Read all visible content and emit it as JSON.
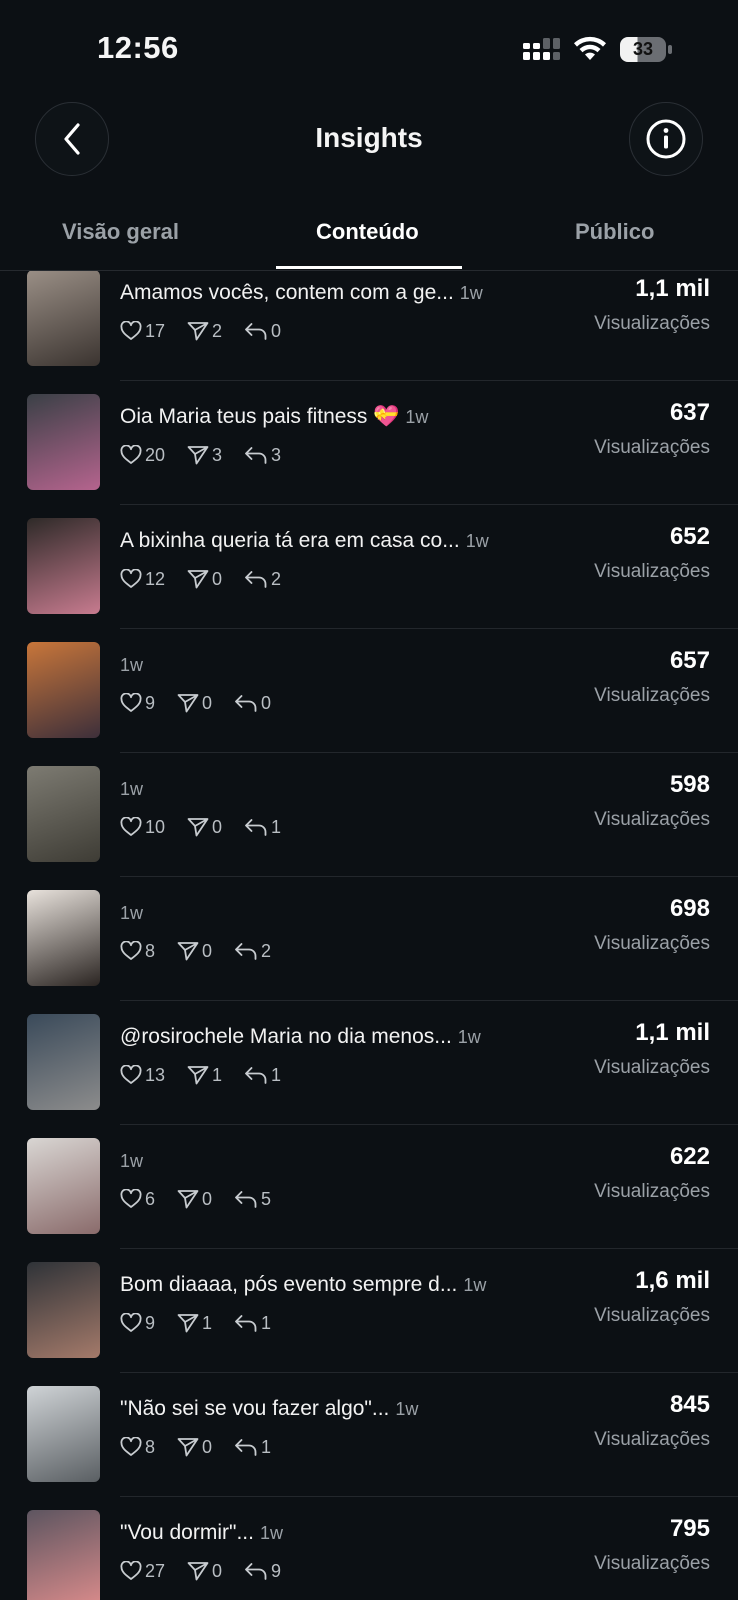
{
  "status": {
    "time": "12:56",
    "battery": "33"
  },
  "header": {
    "title": "Insights"
  },
  "tabs": [
    {
      "label": "Visão geral"
    },
    {
      "label": "Conteúdo"
    },
    {
      "label": "Público"
    }
  ],
  "views_label": "Visualizações",
  "posts": [
    {
      "caption": "Amamos vocês, contem com a ge...",
      "age": "1w",
      "likes": "17",
      "shares": "2",
      "replies": "0",
      "views": "1,1 mil"
    },
    {
      "caption": "Oia Maria teus pais fitness 💝",
      "age": "1w",
      "likes": "20",
      "shares": "3",
      "replies": "3",
      "views": "637"
    },
    {
      "caption": "A bixinha queria tá era em casa co...",
      "age": "1w",
      "likes": "12",
      "shares": "0",
      "replies": "2",
      "views": "652"
    },
    {
      "caption": "",
      "age": "1w",
      "likes": "9",
      "shares": "0",
      "replies": "0",
      "views": "657"
    },
    {
      "caption": "",
      "age": "1w",
      "likes": "10",
      "shares": "0",
      "replies": "1",
      "views": "598"
    },
    {
      "caption": "",
      "age": "1w",
      "likes": "8",
      "shares": "0",
      "replies": "2",
      "views": "698"
    },
    {
      "caption": "@rosirochele  Maria no dia menos...",
      "age": "1w",
      "likes": "13",
      "shares": "1",
      "replies": "1",
      "views": "1,1 mil"
    },
    {
      "caption": "",
      "age": "1w",
      "likes": "6",
      "shares": "0",
      "replies": "5",
      "views": "622"
    },
    {
      "caption": "Bom diaaaa, pós evento sempre d...",
      "age": "1w",
      "likes": "9",
      "shares": "1",
      "replies": "1",
      "views": "1,6 mil"
    },
    {
      "caption": "\"Não sei se vou fazer algo\"...",
      "age": "1w",
      "likes": "8",
      "shares": "0",
      "replies": "1",
      "views": "845"
    },
    {
      "caption": "\"Vou dormir\"...",
      "age": "1w",
      "likes": "27",
      "shares": "0",
      "replies": "9",
      "views": "795"
    }
  ],
  "thumb_colors": [
    [
      "#9a8f86",
      "#3b3430"
    ],
    [
      "#3a4046",
      "#b5648e"
    ],
    [
      "#2e2a28",
      "#c77b8f"
    ],
    [
      "#c8763a",
      "#3d2f3a"
    ],
    [
      "#7d7b72",
      "#3e3c35"
    ],
    [
      "#e8e2dc",
      "#2b2522"
    ],
    [
      "#3a4a5a",
      "#8c8c8c"
    ],
    [
      "#d9d6d3",
      "#8a6b6b"
    ],
    [
      "#2f3338",
      "#a47a6a"
    ],
    [
      "#cfd3d6",
      "#5a5f63"
    ],
    [
      "#5d5560",
      "#d98b8b"
    ]
  ],
  "icons": {
    "like": "heart-icon",
    "share": "send-icon",
    "reply": "reply-icon",
    "back": "chevron-left-icon",
    "info": "info-icon"
  }
}
